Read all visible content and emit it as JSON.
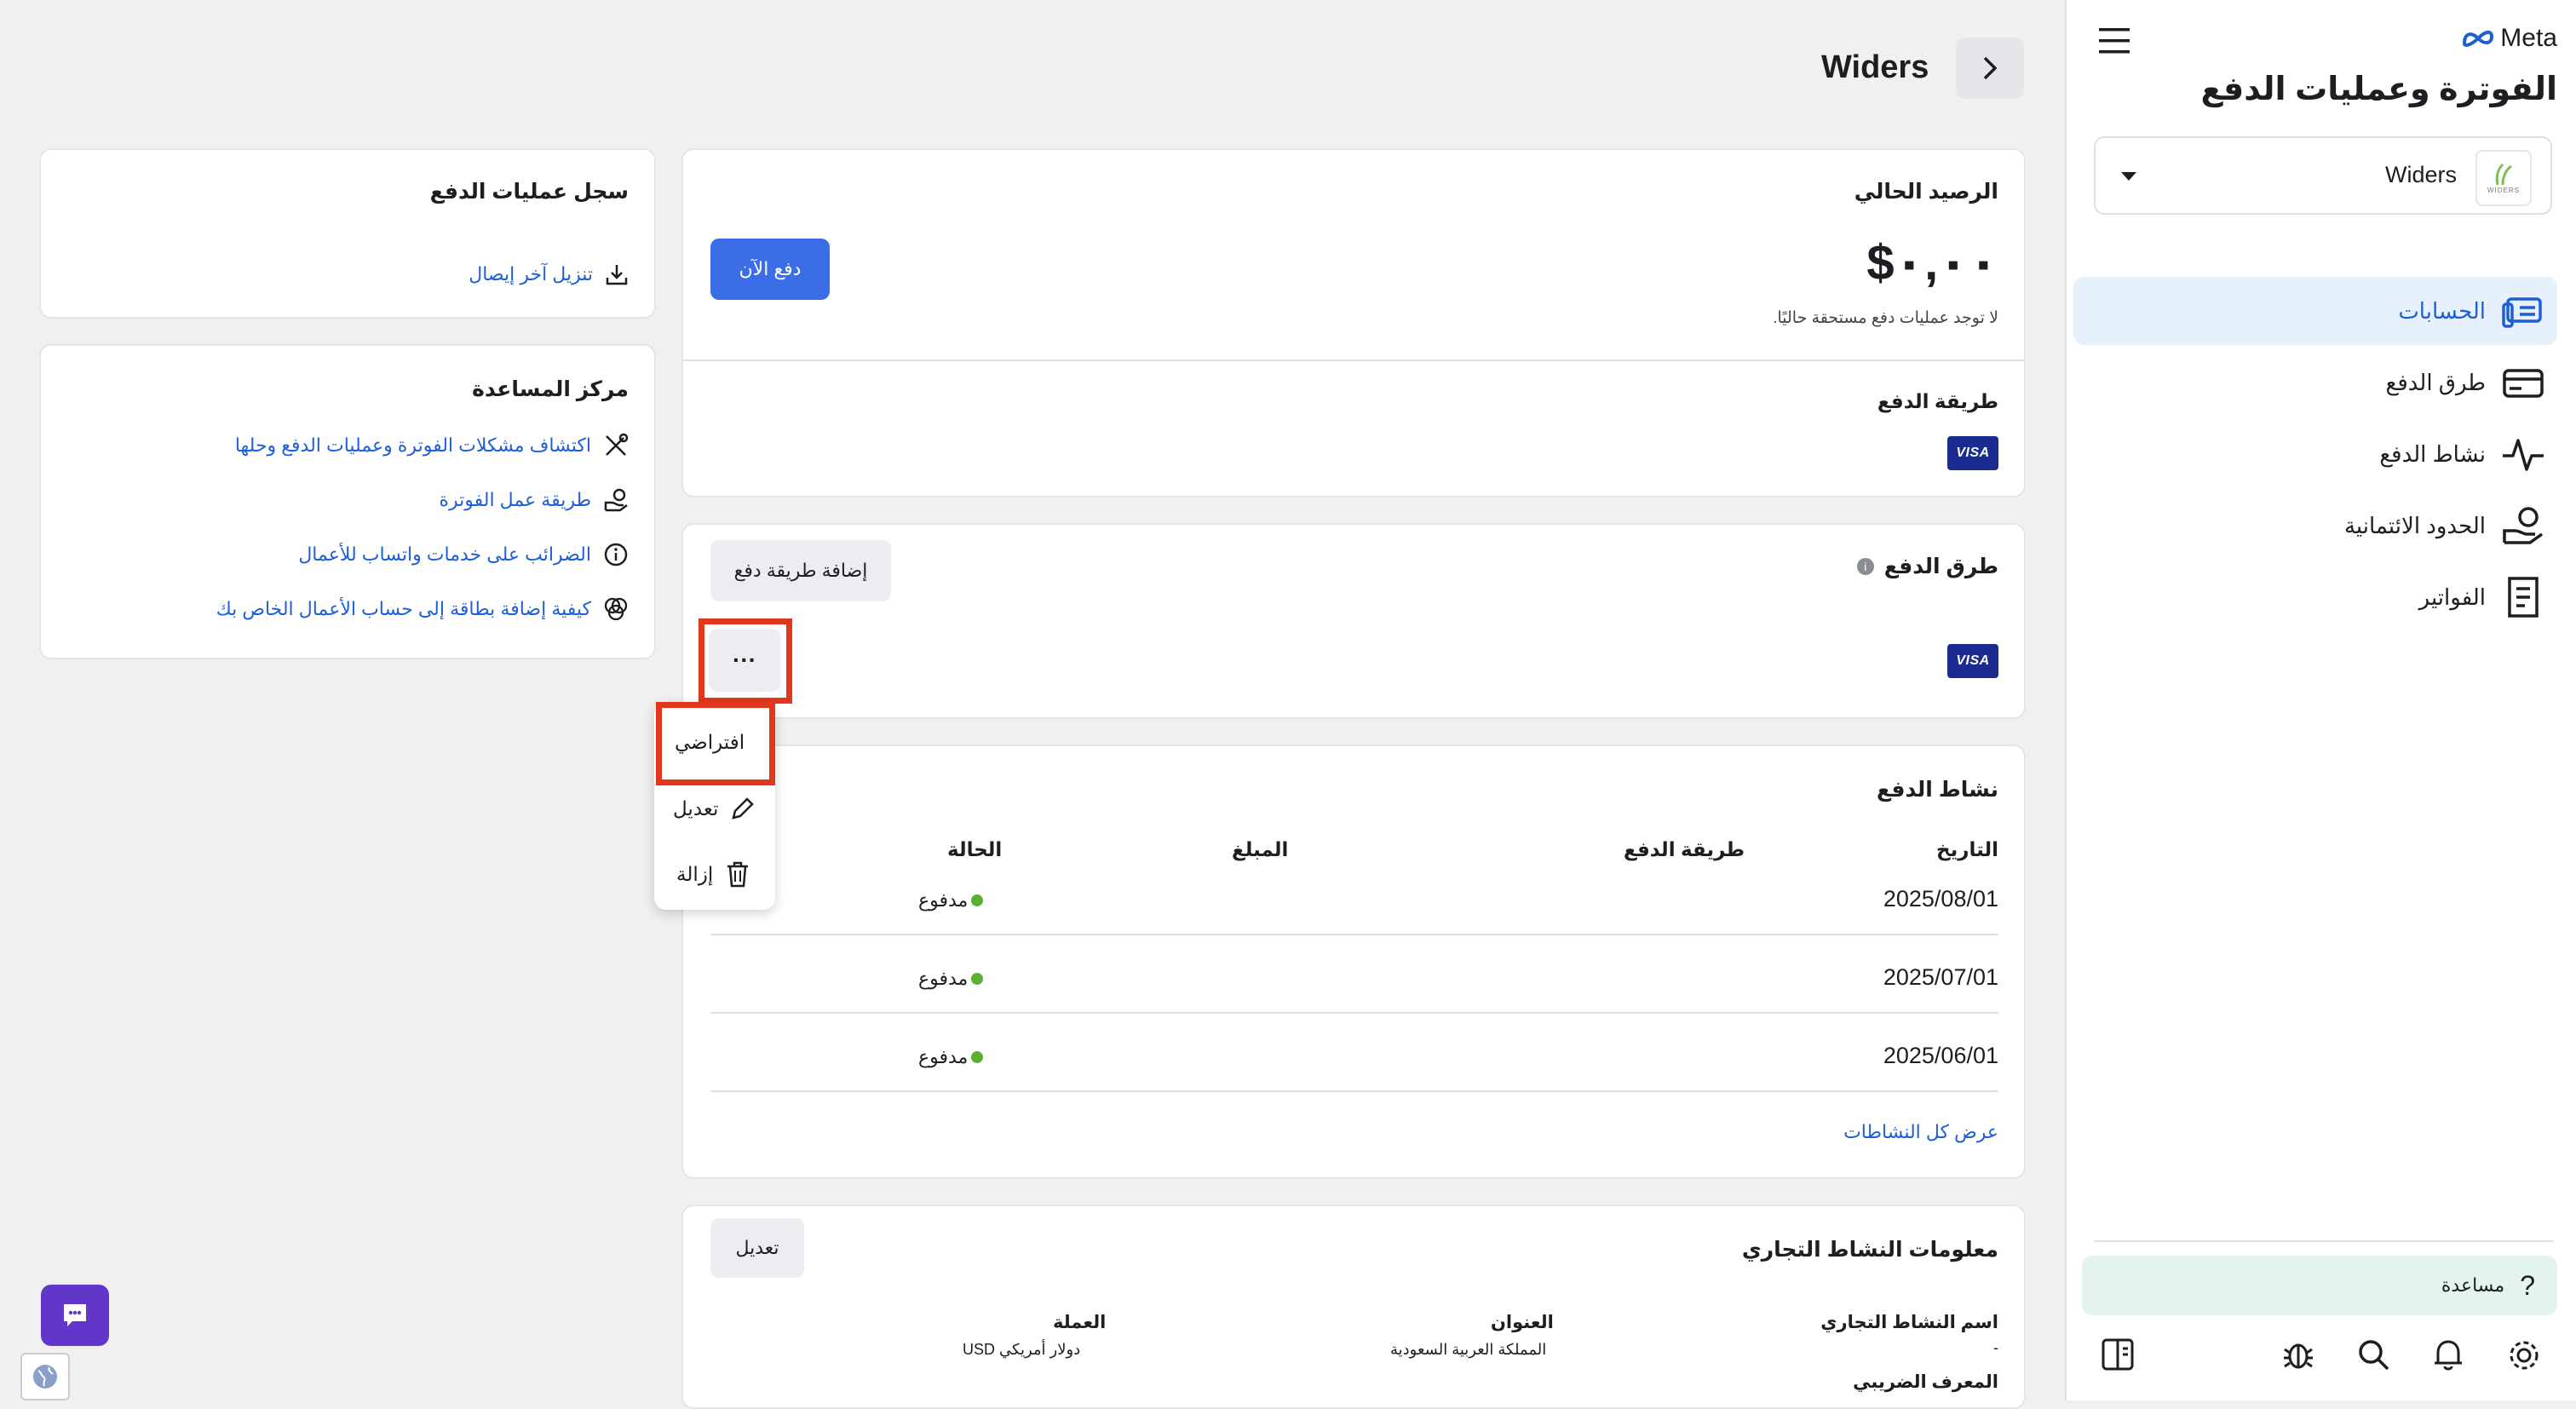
{
  "sidebar": {
    "brand": "Meta",
    "title": "الفوترة وعمليات الدفع",
    "account_selector": {
      "value": "Widers",
      "logo_text": "WIDERS"
    },
    "items": [
      {
        "label": "الحسابات",
        "icon": "accounts-icon",
        "active": true
      },
      {
        "label": "طرق الدفع",
        "icon": "credit-card-icon"
      },
      {
        "label": "نشاط الدفع",
        "icon": "activity-pulse-icon"
      },
      {
        "label": "الحدود الائتمانية",
        "icon": "credit-limit-icon"
      },
      {
        "label": "الفواتير",
        "icon": "invoice-icon"
      }
    ],
    "help_label": "مساعدة"
  },
  "header": {
    "account_name": "Widers"
  },
  "balance": {
    "title": "الرصيد الحالي",
    "amount": "٠,٠٠$",
    "note": "لا توجد عمليات دفع مستحقة حاليًا.",
    "pay_now": "دفع الآن",
    "payment_method_title": "طريقة الدفع",
    "card_brand": "VISA"
  },
  "payment_methods": {
    "title": "طرق الدفع",
    "add_button": "إضافة طريقة دفع",
    "card_brand": "VISA",
    "more_button": "···",
    "menu": {
      "default": "افتراضي",
      "edit": "تعديل",
      "remove": "إزالة"
    }
  },
  "activity": {
    "title": "نشاط الدفع",
    "columns": [
      "التاريخ",
      "طريقة الدفع",
      "المبلغ",
      "الحالة"
    ],
    "rows": [
      {
        "date": "2025/08/01",
        "status": "مدفوع"
      },
      {
        "date": "2025/07/01",
        "status": "مدفوع"
      },
      {
        "date": "2025/06/01",
        "status": "مدفوع"
      }
    ],
    "view_all": "عرض كل النشاطات"
  },
  "business_info": {
    "title": "معلومات النشاط التجاري",
    "edit_button": "تعديل",
    "name_label": "اسم النشاط التجاري",
    "name_value": "-",
    "address_label": "العنوان",
    "address_value": "المملكة العربية السعودية",
    "currency_label": "العملة",
    "currency_value": "دولار أمريكي USD",
    "tax_label": "المعرف الضريبي"
  },
  "history": {
    "title": "سجل عمليات الدفع",
    "download_link": "تنزيل آخر إيصال"
  },
  "help_center": {
    "title": "مركز المساعدة",
    "links": [
      "اكتشاف مشكلات الفوترة وعمليات الدفع وحلها",
      "طريقة عمل الفوترة",
      "الضرائب على خدمات واتساب للأعمال",
      "كيفية إضافة بطاقة إلى حساب الأعمال الخاص بك"
    ]
  },
  "colors": {
    "accent": "#1e5fd6",
    "primary_button": "#3b6ee6",
    "highlight": "#e1371d",
    "paid_dot": "#5ab031",
    "chat_button": "#6236c9"
  }
}
